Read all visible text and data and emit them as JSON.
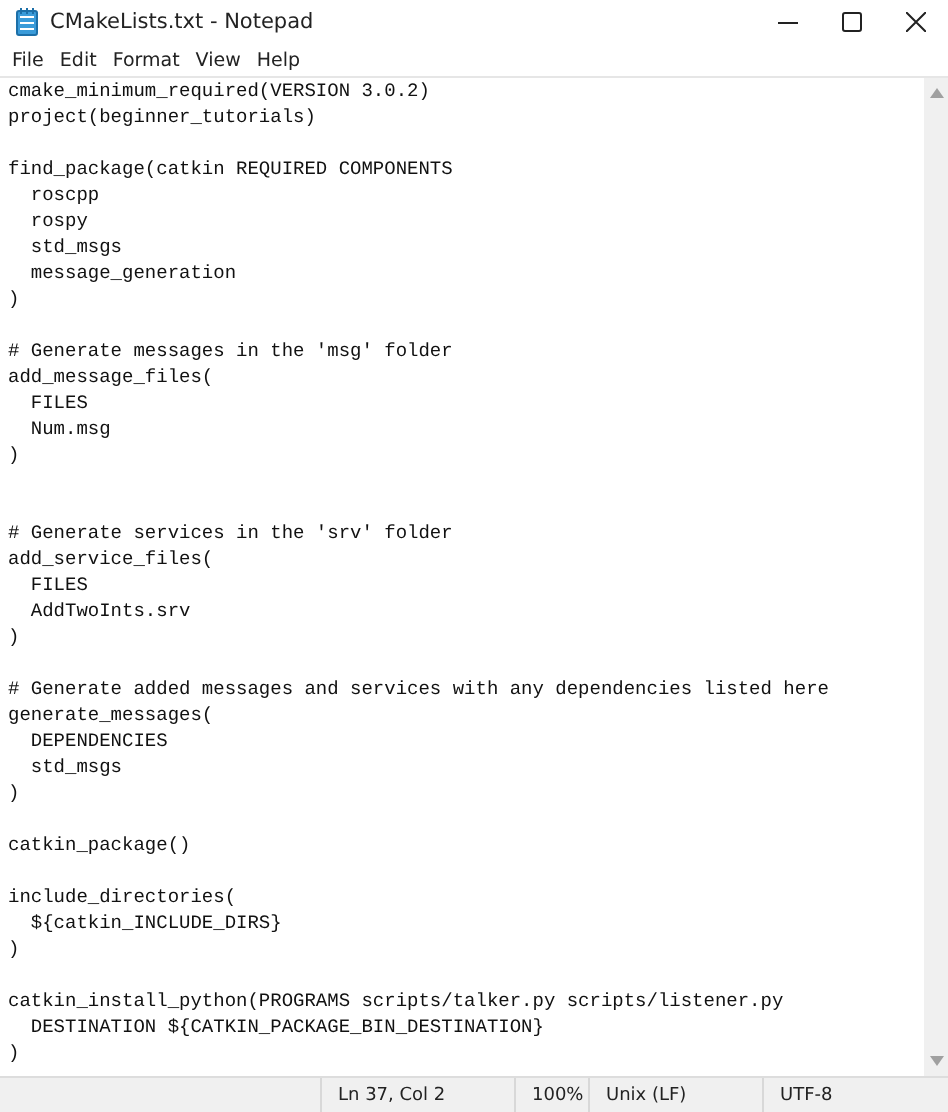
{
  "window": {
    "title": "CMakeLists.txt - Notepad"
  },
  "menu": [
    {
      "label": "File"
    },
    {
      "label": "Edit"
    },
    {
      "label": "Format"
    },
    {
      "label": "View"
    },
    {
      "label": "Help"
    }
  ],
  "editor": {
    "text": "cmake_minimum_required(VERSION 3.0.2)\nproject(beginner_tutorials)\n\nfind_package(catkin REQUIRED COMPONENTS\n  roscpp\n  rospy\n  std_msgs\n  message_generation\n)\n\n# Generate messages in the 'msg' folder\nadd_message_files(\n  FILES\n  Num.msg\n)\n\n\n# Generate services in the 'srv' folder\nadd_service_files(\n  FILES\n  AddTwoInts.srv\n)\n\n# Generate added messages and services with any dependencies listed here\ngenerate_messages(\n  DEPENDENCIES\n  std_msgs\n)\n\ncatkin_package()\n\ninclude_directories(\n  ${catkin_INCLUDE_DIRS}\n)\n\ncatkin_install_python(PROGRAMS scripts/talker.py scripts/listener.py\n  DESTINATION ${CATKIN_PACKAGE_BIN_DESTINATION}\n)"
  },
  "status_bar": {
    "position": "Ln 37, Col 2",
    "zoom": "100%",
    "line_ending": "Unix (LF)",
    "encoding": "UTF-8"
  }
}
